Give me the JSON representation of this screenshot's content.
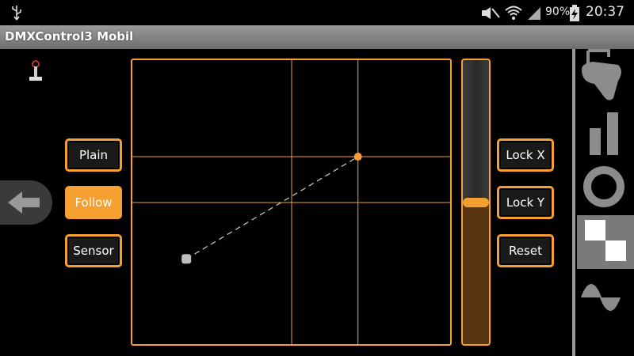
{
  "status": {
    "battery": "90%",
    "time": "20:37"
  },
  "title": "DMXControl3 Mobil",
  "left_buttons": [
    {
      "label": "Plain",
      "active": false
    },
    {
      "label": "Follow",
      "active": true
    },
    {
      "label": "Sensor",
      "active": false
    }
  ],
  "right_buttons": [
    {
      "label": "Lock X"
    },
    {
      "label": "Lock Y"
    },
    {
      "label": "Reset"
    }
  ],
  "pad": {
    "target_x": 0.71,
    "target_y": 0.34,
    "current_x": 0.17,
    "current_y": 0.7
  },
  "slider": {
    "value": 0.5
  },
  "sidebar_icons": [
    "moving-head-icon",
    "bar-chart-icon",
    "ring-icon",
    "checker-icon",
    "sine-wave-icon"
  ],
  "colors": {
    "accent": "#f5a030",
    "background": "#000000"
  }
}
